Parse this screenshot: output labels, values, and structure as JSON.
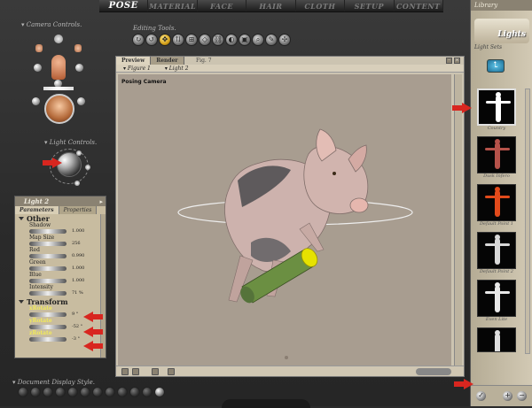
{
  "rooms": [
    "POSE",
    "MATERIAL",
    "FACE",
    "HAIR",
    "CLOTH",
    "SETUP",
    "CONTENT"
  ],
  "camera_controls": {
    "title": "Camera Controls"
  },
  "light_controls": {
    "title": "Light Controls"
  },
  "editing_tools": {
    "title": "Editing Tools",
    "active_index": 2
  },
  "parameters_panel": {
    "title": "Light 2",
    "tabs": [
      "Parameters",
      "Properties"
    ],
    "groups": [
      {
        "name": "Other",
        "params": [
          {
            "label": "Shadow",
            "value": "1.000"
          },
          {
            "label": "Map Size",
            "value": "256"
          },
          {
            "label": "Red",
            "value": "0.990"
          },
          {
            "label": "Green",
            "value": "1.000"
          },
          {
            "label": "Blue",
            "value": "1.000"
          },
          {
            "label": "Intensity",
            "value": "71 %"
          }
        ]
      },
      {
        "name": "Transform",
        "params": [
          {
            "label": "xRotate",
            "value": "9 °"
          },
          {
            "label": "yRotate",
            "value": "-52 °"
          },
          {
            "label": "zRotate",
            "value": "-3 °"
          }
        ]
      }
    ]
  },
  "document": {
    "tabs": [
      "Preview",
      "Render"
    ],
    "title_hint": "Fig. 7",
    "menu": [
      "Figure 1",
      "Light 2"
    ],
    "camera_label": "Posing Camera"
  },
  "document_display_style": {
    "title": "Document Display Style"
  },
  "library": {
    "title": "Library",
    "category": "Lights",
    "subcategory": "Light Sets",
    "up_icon": "up-arrow-icon",
    "items": [
      {
        "name": "Country",
        "color": "#ffffff"
      },
      {
        "name": "Dusk Infero",
        "color": "#b5524a"
      },
      {
        "name": "Default Point 1",
        "color": "#e24a1b"
      },
      {
        "name": "Default Point 2",
        "color": "#d8d8d8"
      },
      {
        "name": "Even Lite",
        "color": "#e8e8e8"
      }
    ]
  },
  "colors": {
    "accent_red": "#d8261f",
    "panel_bg": "#c8bca0"
  }
}
